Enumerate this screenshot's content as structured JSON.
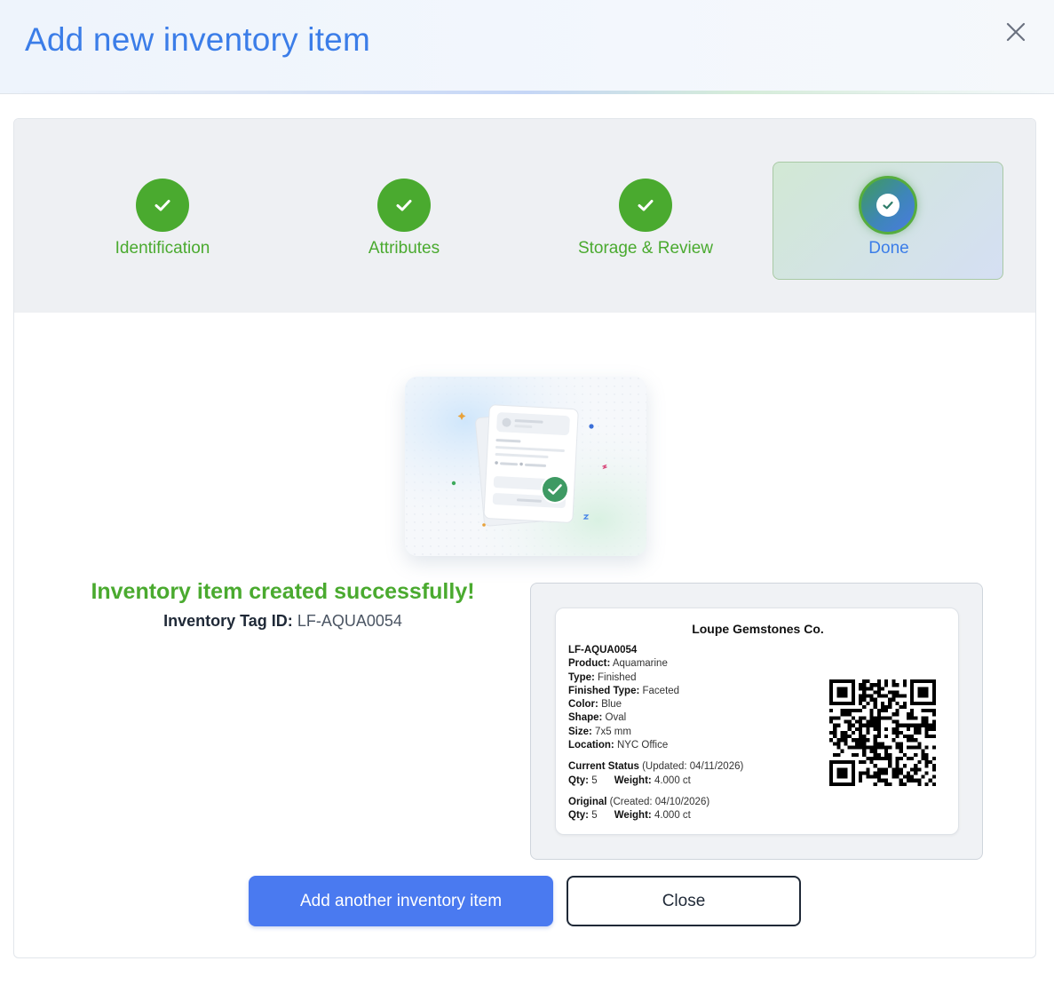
{
  "modal": {
    "title": "Add new inventory item",
    "close_icon": "close-icon"
  },
  "stepper": {
    "steps": [
      {
        "label": "Identification",
        "status": "complete",
        "icon": "check-icon"
      },
      {
        "label": "Attributes",
        "status": "complete",
        "icon": "check-icon"
      },
      {
        "label": "Storage & Review",
        "status": "complete",
        "icon": "check-icon"
      },
      {
        "label": "Done",
        "status": "current",
        "icon": "check-icon"
      }
    ]
  },
  "result": {
    "success_message": "Inventory item created successfully!",
    "tag_label": "Inventory Tag ID:",
    "tag_value": "LF-AQUA0054"
  },
  "label": {
    "company": "Loupe Gemstones Co.",
    "tag_id": "LF-AQUA0054",
    "fields": [
      {
        "key": "Product:",
        "value": "Aquamarine"
      },
      {
        "key": "Type:",
        "value": "Finished"
      },
      {
        "key": "Finished Type:",
        "value": "Faceted"
      },
      {
        "key": "Color:",
        "value": "Blue"
      },
      {
        "key": "Shape:",
        "value": "Oval"
      },
      {
        "key": "Size:",
        "value": "7x5 mm"
      },
      {
        "key": "Location:",
        "value": "NYC Office"
      }
    ],
    "current_status": {
      "title": "Current Status",
      "updated": "(Updated: 04/11/2026)",
      "qty_label": "Qty:",
      "qty": "5",
      "weight_label": "Weight:",
      "weight": "4.000 ct"
    },
    "original": {
      "title": "Original",
      "created": "(Created: 04/10/2026)",
      "qty_label": "Qty:",
      "qty": "5",
      "weight_label": "Weight:",
      "weight": "4.000 ct"
    }
  },
  "actions": {
    "primary_label": "Add another inventory item",
    "secondary_label": "Close"
  },
  "colors": {
    "title_blue": "#3b7de8",
    "success_green": "#4aaa2f",
    "primary_button": "#4a7af0"
  }
}
